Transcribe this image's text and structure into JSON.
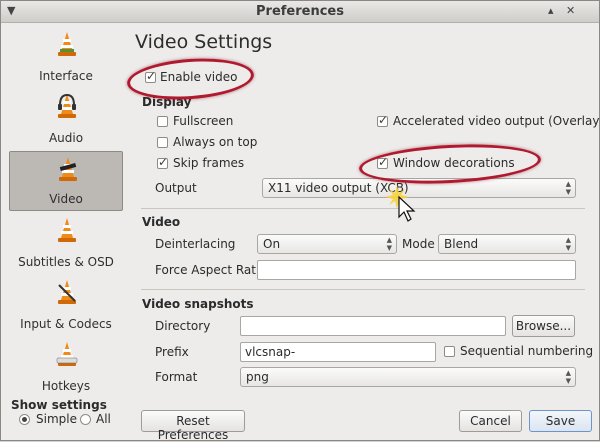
{
  "window": {
    "title": "Preferences"
  },
  "sidebar": {
    "items": [
      {
        "label": "Interface",
        "active": false
      },
      {
        "label": "Audio",
        "active": false
      },
      {
        "label": "Video",
        "active": true
      },
      {
        "label": "Subtitles & OSD",
        "active": false
      },
      {
        "label": "Input & Codecs",
        "active": false
      },
      {
        "label": "Hotkeys",
        "active": false
      }
    ],
    "show_settings": {
      "label": "Show settings",
      "simple": "Simple",
      "all": "All",
      "selected": "Simple"
    }
  },
  "main": {
    "title": "Video Settings",
    "enable_video": {
      "label": "Enable video",
      "checked": true
    },
    "display": {
      "section": "Display",
      "fullscreen": {
        "label": "Fullscreen",
        "checked": false
      },
      "always_on_top": {
        "label": "Always on top",
        "checked": false
      },
      "skip_frames": {
        "label": "Skip frames",
        "checked": true
      },
      "accelerated": {
        "label": "Accelerated video output (Overlay)",
        "checked": true
      },
      "window_decorations": {
        "label": "Window decorations",
        "checked": true
      },
      "output_label": "Output",
      "output_value": "X11 video output (XCB)"
    },
    "video": {
      "section": "Video",
      "deinterlacing_label": "Deinterlacing",
      "deinterlacing_value": "On",
      "mode_label": "Mode",
      "mode_value": "Blend",
      "aspect_label": "Force Aspect Ratio",
      "aspect_value": ""
    },
    "snapshots": {
      "section": "Video snapshots",
      "directory_label": "Directory",
      "directory_value": "",
      "browse_label": "Browse...",
      "prefix_label": "Prefix",
      "prefix_value": "vlcsnap-",
      "sequential": {
        "label": "Sequential numbering",
        "checked": false
      },
      "format_label": "Format",
      "format_value": "png"
    }
  },
  "footer": {
    "reset_label": "Reset Preferences",
    "cancel_label": "Cancel",
    "save_label": "Save"
  },
  "colors": {
    "highlight_ellipse": "#b11a2e",
    "cone_orange": "#f08a18"
  }
}
